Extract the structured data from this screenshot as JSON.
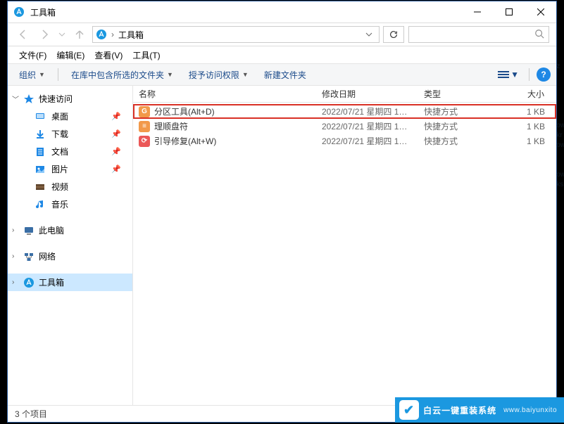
{
  "window": {
    "title": "工具箱"
  },
  "address": {
    "location": "工具箱"
  },
  "search": {
    "icon_name": "search"
  },
  "menubar": [
    {
      "label": "文件(F)"
    },
    {
      "label": "编辑(E)"
    },
    {
      "label": "查看(V)"
    },
    {
      "label": "工具(T)"
    }
  ],
  "toolbar": {
    "organize": "组织",
    "include": "在库中包含所选的文件夹",
    "grant": "授予访问权限",
    "newfolder": "新建文件夹"
  },
  "nav": {
    "quick": {
      "label": "快速访问",
      "items": [
        {
          "label": "桌面",
          "icon": "desktop",
          "color": "#1e88e5"
        },
        {
          "label": "下载",
          "icon": "download",
          "color": "#1e88e5"
        },
        {
          "label": "文档",
          "icon": "document",
          "color": "#1e88e5"
        },
        {
          "label": "图片",
          "icon": "picture",
          "color": "#1e88e5"
        },
        {
          "label": "视频",
          "icon": "video",
          "color": "#7b5c3e"
        },
        {
          "label": "音乐",
          "icon": "music",
          "color": "#1e88e5"
        }
      ]
    },
    "thispc": {
      "label": "此电脑"
    },
    "network": {
      "label": "网络"
    },
    "toolbox": {
      "label": "工具箱"
    }
  },
  "columns": {
    "name": "名称",
    "date": "修改日期",
    "type": "类型",
    "size": "大小"
  },
  "files": [
    {
      "name": "分区工具(Alt+D)",
      "date": "2022/07/21 星期四 1…",
      "type": "快捷方式",
      "size": "1 KB",
      "icon_bg": "#f2994a",
      "icon_text": "G",
      "highlight": true
    },
    {
      "name": "理顺盘符",
      "date": "2022/07/21 星期四 1…",
      "type": "快捷方式",
      "size": "1 KB",
      "icon_bg": "#f2994a",
      "icon_text": "≡",
      "highlight": false
    },
    {
      "name": "引导修复(Alt+W)",
      "date": "2022/07/21 星期四 1…",
      "type": "快捷方式",
      "size": "1 KB",
      "icon_bg": "#eb5757",
      "icon_text": "⟳",
      "highlight": false
    }
  ],
  "status": {
    "text": "3 个项目"
  },
  "watermark": {
    "main": "白云一键重装系统",
    "sub": "www.baiyunxito"
  }
}
